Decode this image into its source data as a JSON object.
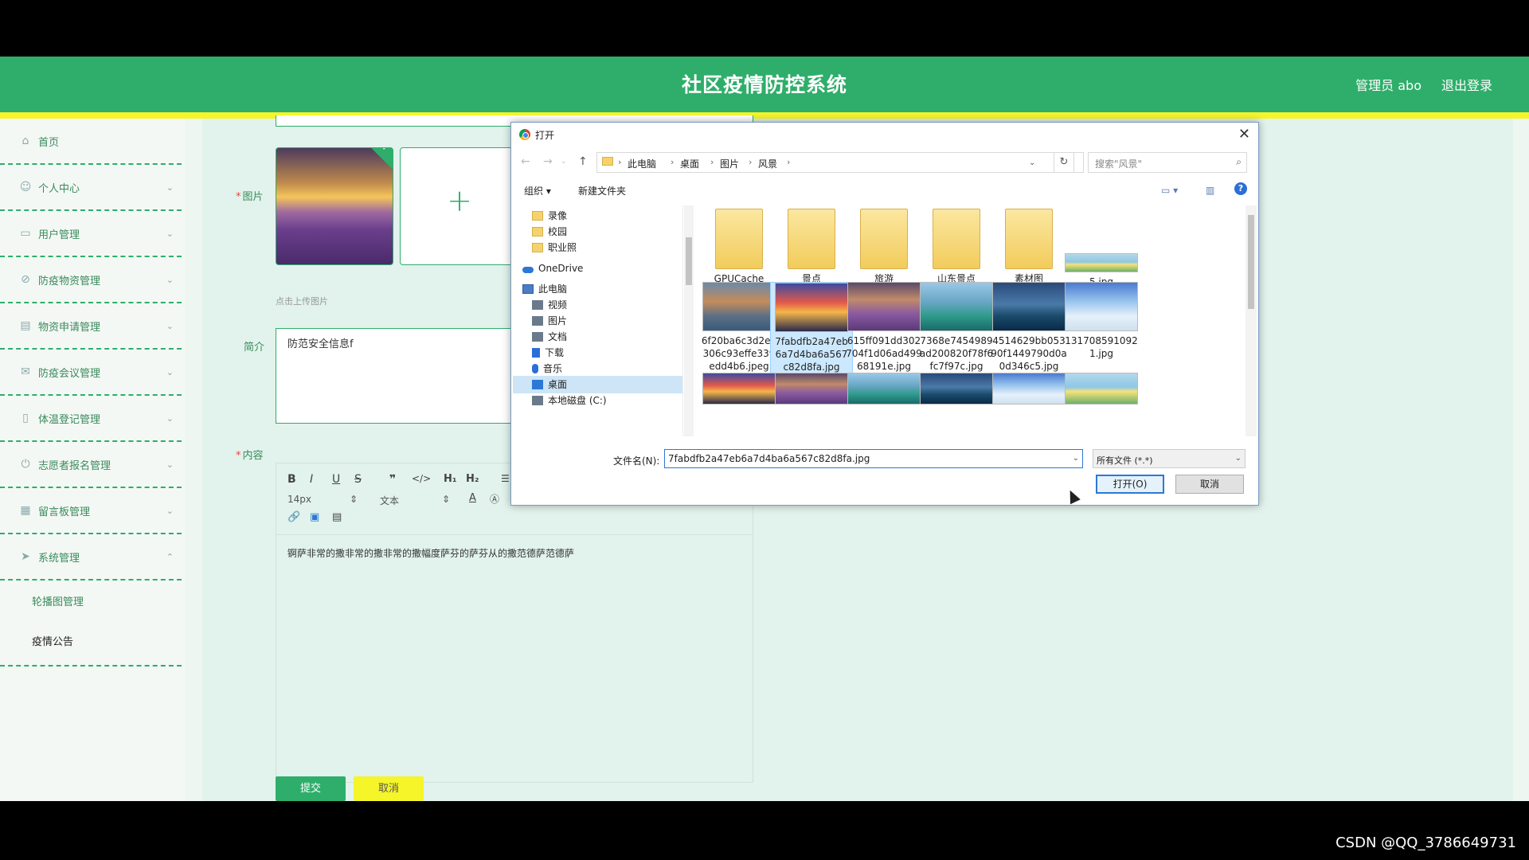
{
  "header": {
    "title": "社区疫情防控系统",
    "admin": "管理员 abo",
    "logout": "退出登录"
  },
  "sidebar": {
    "items": [
      {
        "label": "首页",
        "icon": "home-icon",
        "chevron": ""
      },
      {
        "label": "个人中心",
        "icon": "user-icon",
        "chevron": "⌄"
      },
      {
        "label": "用户管理",
        "icon": "chat-icon",
        "chevron": "⌄"
      },
      {
        "label": "防疫物资管理",
        "icon": "box-icon",
        "chevron": "⌄"
      },
      {
        "label": "物资申请管理",
        "icon": "clipboard-icon",
        "chevron": "⌄"
      },
      {
        "label": "防疫会议管理",
        "icon": "mail-icon",
        "chevron": "⌄"
      },
      {
        "label": "体温登记管理",
        "icon": "thermometer-icon",
        "chevron": "⌄"
      },
      {
        "label": "志愿者报名管理",
        "icon": "power-icon",
        "chevron": "⌄"
      },
      {
        "label": "留言板管理",
        "icon": "grid-icon",
        "chevron": "⌄"
      },
      {
        "label": "系统管理",
        "icon": "send-icon",
        "chevron": "⌃"
      }
    ],
    "sub_items": [
      "轮播图管理",
      "疫情公告"
    ]
  },
  "form": {
    "image_label": "图片",
    "upload_hint": "点击上传图片",
    "intro_label": "简介",
    "intro_value": "防范安全信息f",
    "content_label": "内容",
    "font_size": "14px",
    "text_style": "文本",
    "editor_text": "锕萨非常的撒非常的撒非常的撒幅度萨芬的萨芬从的撒范德萨范德萨",
    "submit": "提交",
    "cancel": "取消"
  },
  "dialog": {
    "title": "打开",
    "breadcrumb": [
      "此电脑",
      "桌面",
      "图片",
      "风景"
    ],
    "search_placeholder": "搜索\"风景\"",
    "organize": "组织 ▾",
    "new_folder": "新建文件夹",
    "tree": [
      {
        "label": "录像",
        "type": "folder"
      },
      {
        "label": "校园",
        "type": "folder"
      },
      {
        "label": "职业照",
        "type": "folder"
      },
      {
        "label": "OneDrive",
        "type": "cloud"
      },
      {
        "label": "此电脑",
        "type": "pc"
      },
      {
        "label": "视频",
        "type": "sys"
      },
      {
        "label": "图片",
        "type": "sys"
      },
      {
        "label": "文档",
        "type": "sys"
      },
      {
        "label": "下载",
        "type": "down"
      },
      {
        "label": "音乐",
        "type": "music"
      },
      {
        "label": "桌面",
        "type": "desk"
      },
      {
        "label": "本地磁盘 (C:)",
        "type": "sys"
      }
    ],
    "files": [
      {
        "name": "GPUCache",
        "kind": "folder"
      },
      {
        "name": "景点",
        "kind": "folder"
      },
      {
        "name": "旅游",
        "kind": "folder"
      },
      {
        "name": "山东景点",
        "kind": "folder"
      },
      {
        "name": "素材图",
        "kind": "folder"
      },
      {
        "name": "5.jpg",
        "kind": "image"
      },
      {
        "name": "6f20ba6c3d2e1306c93effe339edd4b6.jpeg",
        "kind": "image"
      },
      {
        "name": "7fabdfb2a47eb6a7d4ba6a567c82d8fa.jpg",
        "kind": "image",
        "selected": true
      },
      {
        "name": "615ff091dd302704f1d06ad49968191e.jpg",
        "kind": "image"
      },
      {
        "name": "7368e7454989ad200820f78f6fc7f97c.jpg",
        "kind": "image"
      },
      {
        "name": "4514629bb05390f1449790d0a0d346c5.jpg",
        "kind": "image"
      },
      {
        "name": "1317085910921.jpg",
        "kind": "image"
      }
    ],
    "file_name_label": "文件名(N):",
    "file_name_value": "7fabdfb2a47eb6a7d4ba6a567c82d8fa.jpg",
    "file_type": "所有文件 (*.*)",
    "open_button": "打开(O)",
    "cancel_button": "取消"
  },
  "watermark": "CSDN @QQ_3786649731"
}
